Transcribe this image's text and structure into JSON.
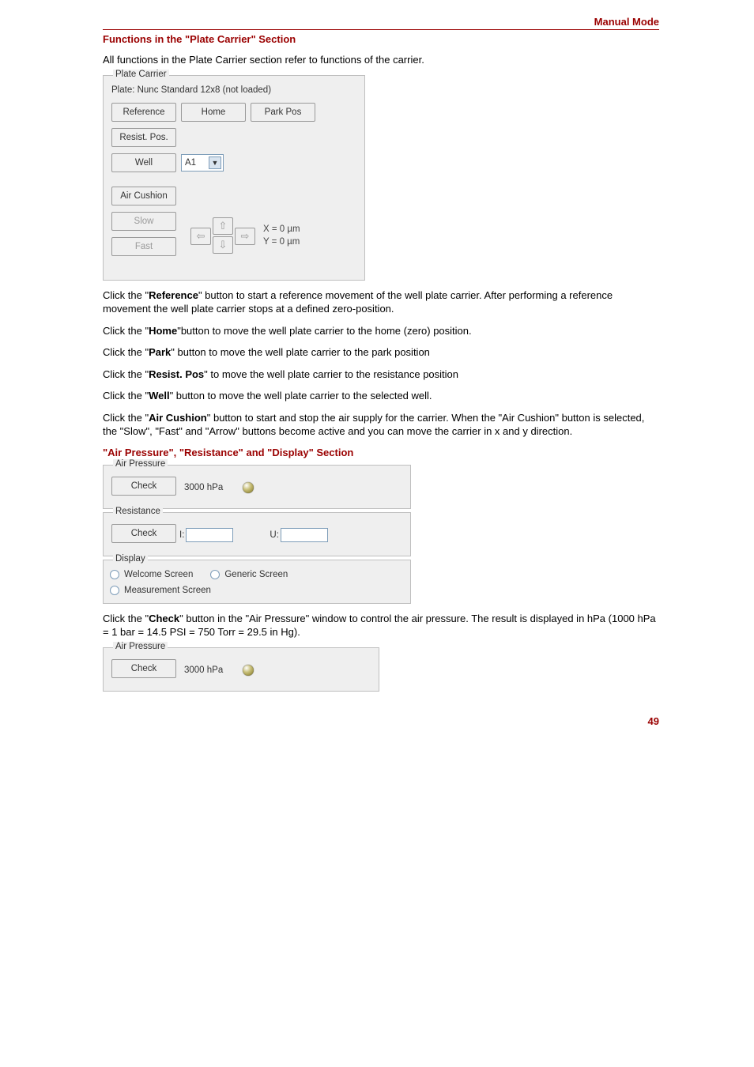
{
  "header": {
    "title": "Manual Mode"
  },
  "section1": {
    "title": "Functions in the \"Plate Carrier\" Section"
  },
  "intro1": "All functions in the Plate Carrier section refer to functions of the carrier.",
  "plateCarrier": {
    "legend": "Plate Carrier",
    "plateLabel": "Plate: Nunc Standard 12x8 (not loaded)",
    "buttons": {
      "reference": "Reference",
      "home": "Home",
      "parkPos": "Park Pos",
      "resistPos": "Resist. Pos.",
      "well": "Well",
      "airCushion": "Air Cushion",
      "slow": "Slow",
      "fast": "Fast"
    },
    "wellSelect": "A1",
    "xy": {
      "x": "X = 0 µm",
      "y": "Y = 0 µm"
    }
  },
  "clickRef": {
    "pre": "Click the \"",
    "b": "Reference",
    "post": "\" button to start a reference movement of the well plate carrier. After performing a reference movement the well plate carrier stops at a defined zero-position."
  },
  "clickHome": {
    "pre": "Click the \"",
    "b": "Home",
    "post": "\"button to move the well plate carrier to the home (zero) position."
  },
  "clickPark": {
    "pre": "Click the \"",
    "b": "Park",
    "post": "\" button to move the well plate carrier to the park position"
  },
  "clickResist": {
    "pre": "Click the \"",
    "b": "Resist. Pos",
    "post": "\" to move the well plate carrier to the resistance position"
  },
  "clickWell": {
    "pre": "Click the \"",
    "b": "Well",
    "post": "\" button to move the well plate carrier to the selected well."
  },
  "clickAir": {
    "pre": "Click the \"",
    "b": "Air Cushion",
    "post": "\" button to start and stop the air supply for the carrier. When the \"Air Cushion\" button is selected, the \"Slow\", \"Fast\" and \"Arrow\" buttons become active and you can move the carrier in x and y direction."
  },
  "section2": {
    "title": "\"Air Pressure\", \"Resistance\" and \"Display\" Section"
  },
  "airPressure": {
    "legend": "Air Pressure",
    "check": "Check",
    "value": "3000 hPa"
  },
  "resistance": {
    "legend": "Resistance",
    "check": "Check",
    "iLabel": "I:",
    "uLabel": "U:"
  },
  "display": {
    "legend": "Display",
    "welcome": "Welcome Screen",
    "generic": "Generic Screen",
    "measurement": "Measurement Screen"
  },
  "clickCheck": {
    "pre": "Click the \"",
    "b": "Check",
    "post": "\" button in the \"Air Pressure\" window to control the air pressure. The result is displayed in hPa (1000 hPa = 1 bar = 14.5 PSI = 750 Torr = 29.5 in Hg)."
  },
  "airPressure2": {
    "legend": "Air Pressure",
    "check": "Check",
    "value": "3000 hPa"
  },
  "pageNumber": "49"
}
